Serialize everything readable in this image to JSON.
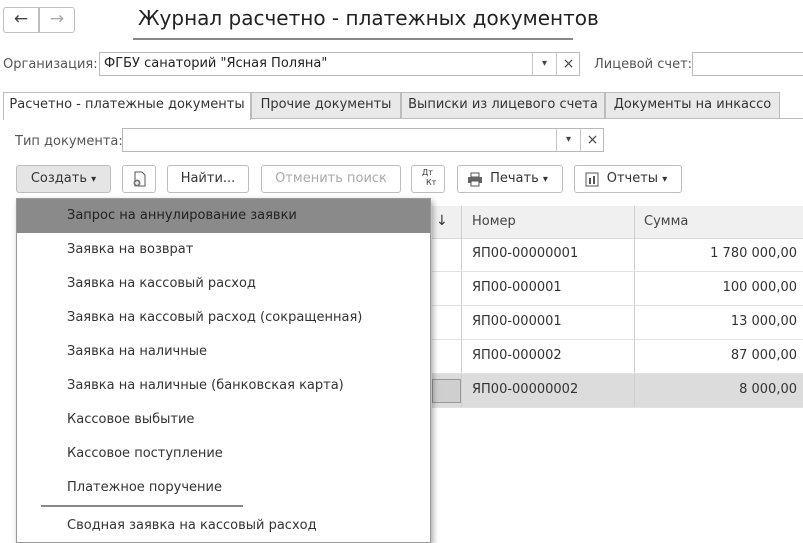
{
  "window": {
    "title": "Журнал расчетно - платежных документов",
    "back_icon": "←",
    "forward_icon": "→"
  },
  "filters": {
    "org_label": "Организация:",
    "org_value": "ФГБУ санаторий \"Ясная Поляна\"",
    "account_label": "Лицевой счет:",
    "doc_type_label": "Тип документа:",
    "doc_type_value": "",
    "dropdown_icon": "▾",
    "clear_icon": "×"
  },
  "tabs": [
    {
      "label": "Расчетно - платежные документы",
      "active": true
    },
    {
      "label": "Прочие документы"
    },
    {
      "label": "Выписки из лицевого счета"
    },
    {
      "label": "Документы на инкассо"
    }
  ],
  "toolbar": {
    "create": "Создать",
    "find": "Найти...",
    "cancel_search": "Отменить поиск",
    "dtkt_top": "Дт",
    "dtkt_bottom": "Кт",
    "print": "Печать",
    "reports": "Отчеты",
    "dropdown_icon": "▾"
  },
  "grid": {
    "sort_icon": "↓",
    "headers": {
      "number": "Номер",
      "sum": "Сумма"
    },
    "rows": [
      {
        "number": "ЯП00-00000001",
        "sum": "1 780 000,00"
      },
      {
        "number": "ЯП00-000001",
        "sum": "100 000,00"
      },
      {
        "number": "ЯП00-000001",
        "sum": "13 000,00"
      },
      {
        "number": "ЯП00-000002",
        "sum": "87 000,00"
      },
      {
        "number": "ЯП00-00000002",
        "sum": "8 000,00",
        "selected": true
      }
    ]
  },
  "create_menu": {
    "items": [
      "Запрос на аннулирование заявки",
      "Заявка на возврат",
      "Заявка на кассовый расход",
      "Заявка на кассовый расход (сокращенная)",
      "Заявка на наличные",
      "Заявка на наличные (банковская карта)",
      "Кассовое выбытие",
      "Кассовое поступление",
      "Платежное поручение",
      "Сводная заявка на кассовый расход"
    ],
    "highlighted_index": 0
  }
}
